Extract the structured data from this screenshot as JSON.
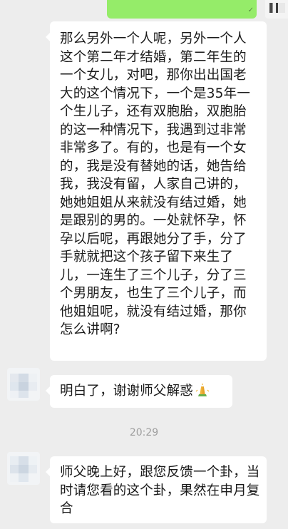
{
  "messages": [
    {
      "sender": "other",
      "text": "那么另外一个人呢，另外一个人这个第二年才结婚，第二年生的一个女儿，对吧，那你出出国老大的这个情况下，一个是35年一个生儿子，还有双胞胎，双胞胎的这一种情况下，我遇到过非常非常多了。有的，也是有一个女的，我是没有替她的话，她告给我，我没有留，人家自己讲的，她她姐姐从来就没有结过婚，她是跟别的男的。一处就怀孕，怀孕以后呢，再跟她分了手，分了手就就把这个孩子留下来生了儿，一连生了三个儿子，分了三个男朋友，也生了三个儿子，而他姐姐呢，就没有结过婚，那你怎么讲啊?"
    },
    {
      "sender": "me",
      "text": "明白了，谢谢师父解惑",
      "emoji": "pray-icon"
    },
    {
      "sender": "me",
      "text": "师父晚上好，跟您反馈一个卦，当时请您看的这个卦，果然在申月复合"
    }
  ],
  "timestamp": "20:29",
  "colors": {
    "background": "#ededed",
    "bubble_in": "#ffffff",
    "bubble_out": "#95ec69",
    "timestamp_text": "#9e9e9e"
  }
}
